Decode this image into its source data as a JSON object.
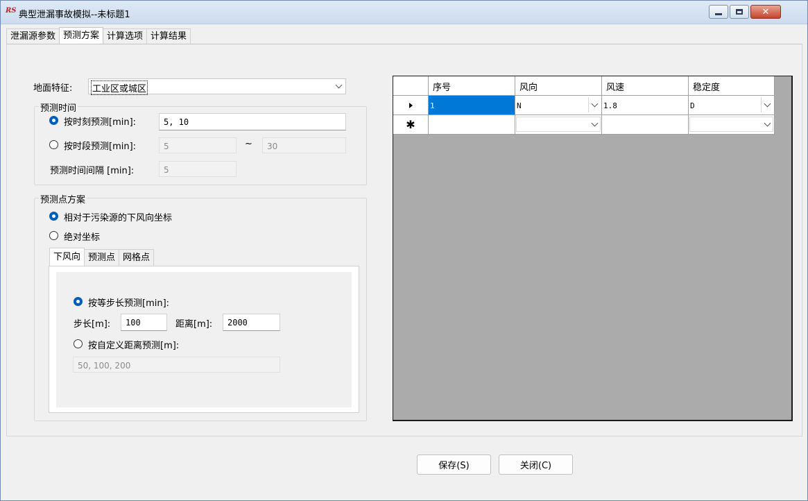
{
  "window": {
    "logo_text": "RS",
    "title": "典型泄漏事故模拟--未标题1",
    "close_glyph": "✕"
  },
  "tabs": [
    {
      "label": "泄漏源参数"
    },
    {
      "label": "预测方案"
    },
    {
      "label": "计算选项"
    },
    {
      "label": "计算结果"
    }
  ],
  "active_tab": "预测方案",
  "terrain": {
    "label": "地面特征:",
    "value": "工业区或城区"
  },
  "predict_time": {
    "group_title": "预测时间",
    "by_moment_label": "按时刻预测[min]:",
    "by_moment_value": "5, 10",
    "by_moment_checked": true,
    "by_period_label": "按时段预测[min]:",
    "period_from": "5",
    "period_sep": "~",
    "period_to": "30",
    "interval_label": "预测时间间隔 [min]:",
    "interval_value": "5"
  },
  "predict_points": {
    "group_title": "预测点方案",
    "relative_label": "相对于污染源的下风向坐标",
    "relative_checked": true,
    "absolute_label": "绝对坐标",
    "tabs": [
      {
        "label": "下风向"
      },
      {
        "label": "预测点"
      },
      {
        "label": "网格点"
      }
    ],
    "equal_step_label": "按等步长预测[min]:",
    "equal_step_checked": true,
    "step_label": "步长[m]:",
    "step_value": "100",
    "distance_label": "距离[m]:",
    "distance_value": "2000",
    "custom_label": "按自定义距离预测[m]:",
    "custom_value": "50, 100, 200"
  },
  "grid": {
    "columns": [
      "序号",
      "风向",
      "风速",
      "稳定度"
    ],
    "rows": [
      {
        "marker": "▸",
        "index": "1",
        "direction": "N",
        "speed": "1.8",
        "stability": "D"
      }
    ],
    "new_row_marker": "✱"
  },
  "buttons": {
    "save": "保存(S)",
    "close": "关闭(C)"
  }
}
